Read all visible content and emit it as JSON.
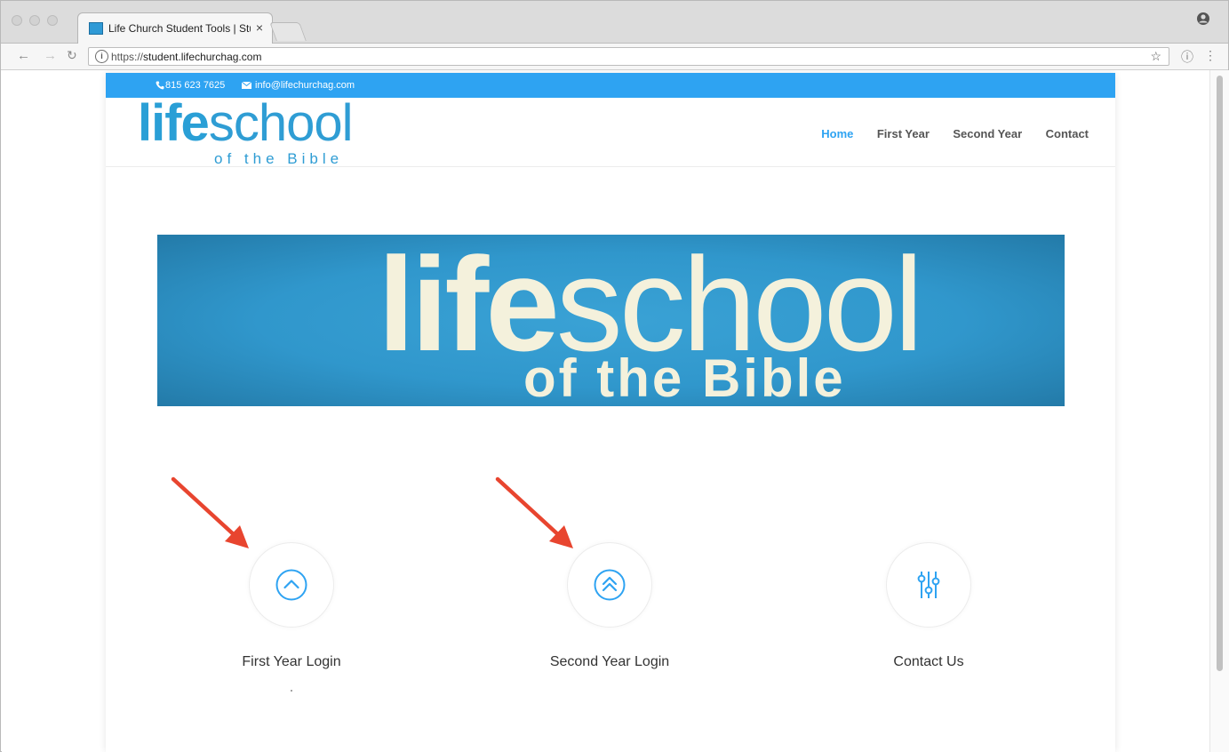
{
  "browser": {
    "tab_title": "Life Church Student Tools | Stu",
    "tab_close": "×",
    "url_scheme": "https://",
    "url_host": "student.lifechurchag.com",
    "star": "☆"
  },
  "topbar": {
    "phone": "815 623 7625",
    "email": "info@lifechurchag.com",
    "color": "#2ea3f2"
  },
  "logo": {
    "bold": "life",
    "light": "school",
    "sub": "of the Bible"
  },
  "nav": {
    "items": [
      "Home",
      "First Year",
      "Second Year",
      "Contact"
    ],
    "active": "Home",
    "accent": "#2ea3f2"
  },
  "banner": {
    "bold": "life",
    "light": "school",
    "sub": "of the Bible"
  },
  "features": [
    {
      "title": "First Year Login",
      "icon": "chevron-up-circle-icon"
    },
    {
      "title": "Second Year Login",
      "icon": "double-chevron-up-circle-icon"
    },
    {
      "title": "Contact Us",
      "icon": "sliders-icon"
    }
  ],
  "annotations": {
    "arrow_color": "#e8452f"
  }
}
